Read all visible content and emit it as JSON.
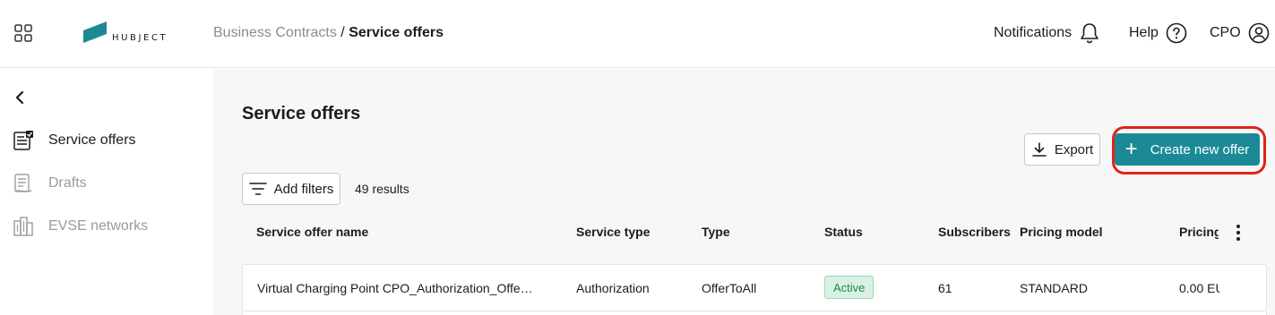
{
  "header": {
    "logo_text": "HUBJECT",
    "breadcrumb": {
      "parent": "Business Contracts",
      "separator": " / ",
      "current": "Service offers"
    },
    "notifications_label": "Notifications",
    "help_label": "Help",
    "user_label": "CPO",
    "icons": [
      "apps-grid-icon",
      "bell-icon",
      "help-circle-icon",
      "user-circle-icon"
    ]
  },
  "sidebar": {
    "items": [
      {
        "label": "Service offers",
        "icon": "contract-list-icon",
        "active": true
      },
      {
        "label": "Drafts",
        "icon": "draft-document-icon",
        "active": false
      },
      {
        "label": "EVSE networks",
        "icon": "building-network-icon",
        "active": false
      }
    ]
  },
  "main": {
    "title": "Service offers",
    "export_label": "Export",
    "create_label": "Create new offer",
    "filter_label": "Add filters",
    "results_text": "49 results",
    "columns": [
      "Service offer name",
      "Service type",
      "Type",
      "Status",
      "Subscribers",
      "Pricing model",
      "Pricing"
    ],
    "rows": [
      {
        "name": "Virtual Charging Point CPO_Authorization_Offe…",
        "service_type": "Authorization",
        "type": "OfferToAll",
        "status": "Active",
        "subscribers": "61",
        "pricing_model": "STANDARD",
        "pricing": "0.00 EU"
      }
    ]
  },
  "colors": {
    "accent": "#1b8a96",
    "highlight": "#e2231a",
    "status_active_bg": "#d8f1e3",
    "status_active_text": "#1e8a4c"
  }
}
